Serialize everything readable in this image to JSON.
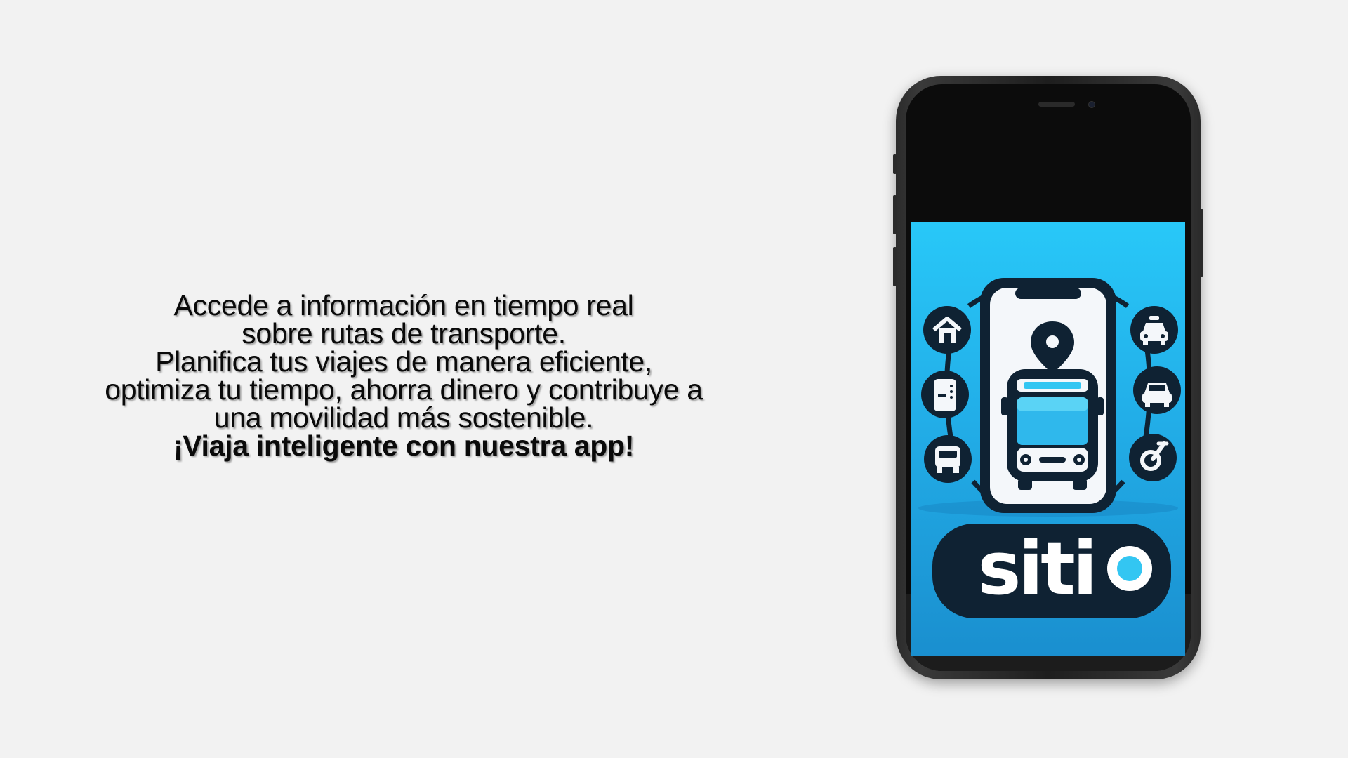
{
  "copy": {
    "line1": "Accede a información en tiempo real",
    "line2": "sobre rutas de transporte.",
    "line3": "Planifica tus viajes de manera eficiente,",
    "line4": "optimiza tu tiempo, ahorra dinero y contribuye a",
    "line5": "una movilidad más sostenible.",
    "cta": "¡Viaja inteligente con nuestra app!"
  },
  "app_logo": {
    "wordmark": "sitio",
    "icons_left": [
      "house-icon",
      "ticket-icon",
      "train-icon"
    ],
    "icons_right": [
      "taxi-icon",
      "car-icon",
      "bicycle-icon"
    ],
    "center_icons": [
      "map-pin-icon",
      "bus-icon"
    ]
  },
  "colors": {
    "background": "#f2f2f2",
    "screen_top": "#28c8f8",
    "screen_bottom": "#1a8fcf",
    "logo_dark": "#0f2233",
    "accent": "#33c6f2"
  }
}
